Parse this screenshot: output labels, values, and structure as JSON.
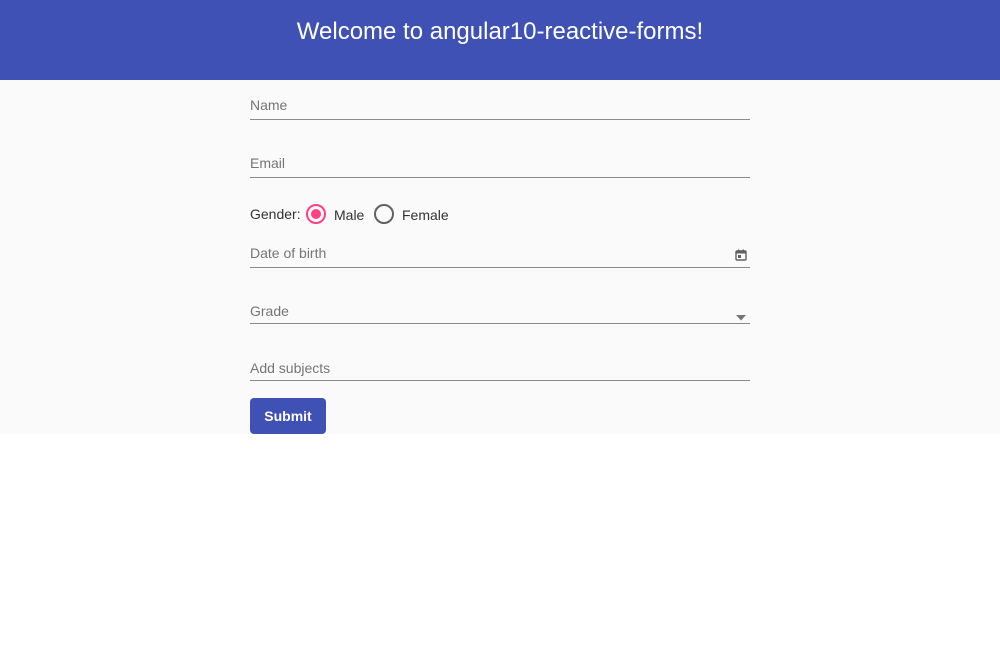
{
  "header": {
    "title": "Welcome to angular10-reactive-forms!",
    "background": "#3f51b5"
  },
  "form": {
    "name_label": "Name",
    "email_label": "Email",
    "gender": {
      "label": "Gender:",
      "options": [
        {
          "label": "Male",
          "checked": true
        },
        {
          "label": "Female",
          "checked": false
        }
      ]
    },
    "dob_label": "Date of birth",
    "dob_icon": "calendar-icon",
    "grade_label": "Grade",
    "grade_icon": "dropdown-arrow-icon",
    "subjects_label": "Add subjects",
    "submit_label": "Submit"
  },
  "colors": {
    "primary": "#3f51b5",
    "accent": "#ff4081",
    "content_bg": "#fafafa"
  }
}
